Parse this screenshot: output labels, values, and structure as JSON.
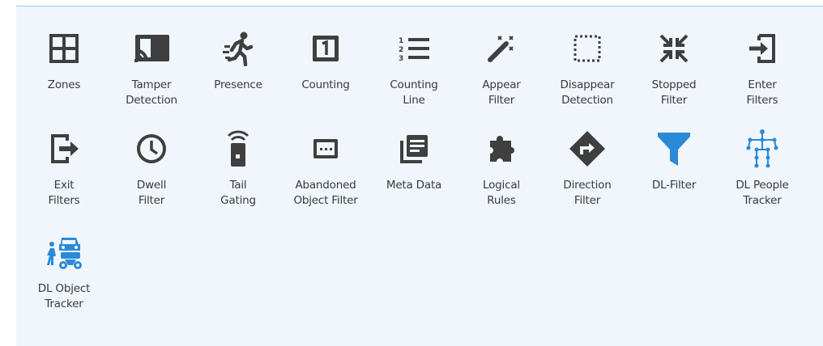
{
  "colors": {
    "icon_dark": "#3f3f3f",
    "icon_blue": "#2a8ad8",
    "panel_bg": "#f0f6fc"
  },
  "tools": [
    {
      "label": "Zones",
      "icon": "grid-icon"
    },
    {
      "label": "Tamper\nDetection",
      "icon": "cast-icon"
    },
    {
      "label": "Presence",
      "icon": "running-person-icon"
    },
    {
      "label": "Counting",
      "icon": "counter-one-icon"
    },
    {
      "label": "Counting\nLine",
      "icon": "numbered-list-icon"
    },
    {
      "label": "Appear\nFilter",
      "icon": "magic-wand-icon"
    },
    {
      "label": "Disappear\nDetection",
      "icon": "dotted-square-icon"
    },
    {
      "label": "Stopped\nFilter",
      "icon": "collapse-arrows-icon"
    },
    {
      "label": "Enter\nFilters",
      "icon": "login-icon"
    },
    {
      "label": "Exit\nFilters",
      "icon": "logout-icon"
    },
    {
      "label": "Dwell\nFilter",
      "icon": "clock-icon"
    },
    {
      "label": "Tail\nGating",
      "icon": "wireless-badge-icon"
    },
    {
      "label": "Abandoned\nObject Filter",
      "icon": "dotted-box-icon"
    },
    {
      "label": "Meta Data",
      "icon": "library-books-icon"
    },
    {
      "label": "Logical\nRules",
      "icon": "puzzle-icon"
    },
    {
      "label": "Direction\nFilter",
      "icon": "direction-sign-icon"
    },
    {
      "label": "DL-Filter",
      "icon": "funnel-icon"
    },
    {
      "label": "DL People\nTracker",
      "icon": "skeleton-tracker-icon"
    },
    {
      "label": "DL Object\nTracker",
      "icon": "object-tracker-icon"
    }
  ]
}
